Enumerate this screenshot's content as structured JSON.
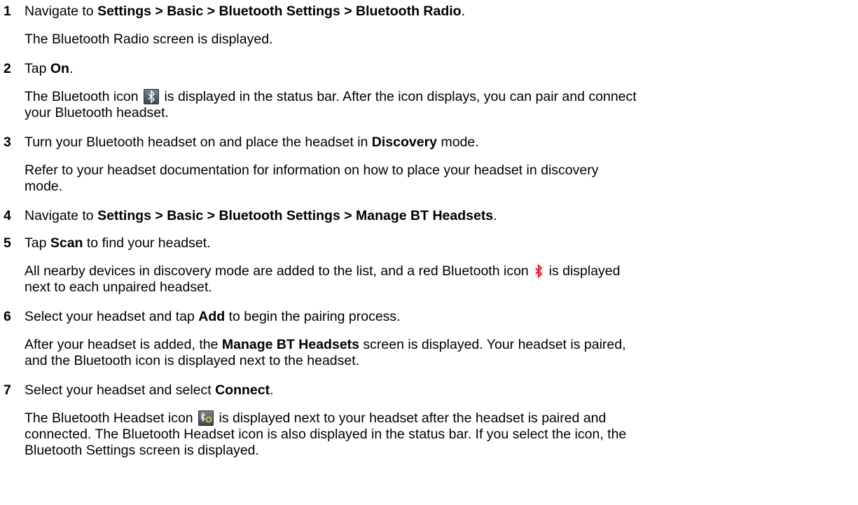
{
  "steps": [
    {
      "num": "1",
      "instruction": {
        "t1": "Navigate to ",
        "b1": "Settings > Basic > Bluetooth Settings > Bluetooth Radio",
        "t2": "."
      },
      "result": "The Bluetooth Radio screen is displayed."
    },
    {
      "num": "2",
      "instruction": {
        "t1": "Tap ",
        "b1": "On",
        "t2": "."
      },
      "result": {
        "l1a": "The Bluetooth icon",
        "l1b": " is displayed in the status bar. After the icon displays, you can pair and connect",
        "l2": "your Bluetooth headset."
      }
    },
    {
      "num": "3",
      "instruction": {
        "t1": "Turn your Bluetooth headset on and place the headset in ",
        "b1": "Discovery",
        "t2": " mode."
      },
      "result": {
        "l1": "Refer to your headset documentation for information on how to place your headset in discovery",
        "l2": "mode."
      }
    },
    {
      "num": "4",
      "instruction": {
        "t1": "Navigate to ",
        "b1": "Settings > Basic > Bluetooth Settings > Manage BT Headsets",
        "t2": "."
      }
    },
    {
      "num": "5",
      "instruction": {
        "t1": "Tap ",
        "b1": "Scan",
        "t2": " to find your headset."
      },
      "result": {
        "l1a": "All nearby devices in discovery mode are added to the list, and a red Bluetooth icon",
        "l1b": " is displayed",
        "l2": "next to each unpaired headset."
      }
    },
    {
      "num": "6",
      "instruction": {
        "t1": "Select your headset and tap ",
        "b1": "Add",
        "t2": " to begin the pairing process."
      },
      "result": {
        "l1a": "After your headset is added, the ",
        "l1b": "Manage BT Headsets",
        "l1c": " screen is displayed. Your headset is paired,",
        "l2": "and the Bluetooth icon is displayed next to the headset."
      }
    },
    {
      "num": "7",
      "instruction": {
        "t1": "Select your headset and select ",
        "b1": "Connect",
        "t2": "."
      },
      "result": {
        "l1a": "The Bluetooth Headset icon",
        "l1b": " is displayed next to your headset after the headset is paired and",
        "l2": "connected. The Bluetooth Headset icon is also displayed in the status bar. If you select the icon, the",
        "l3": "Bluetooth Settings screen is displayed."
      }
    }
  ],
  "icons": {
    "bluetooth_status": "bluetooth-icon",
    "bluetooth_unpaired": "red-bluetooth-icon",
    "bluetooth_headset": "bluetooth-headset-icon",
    "red_color": "#e0202a"
  }
}
